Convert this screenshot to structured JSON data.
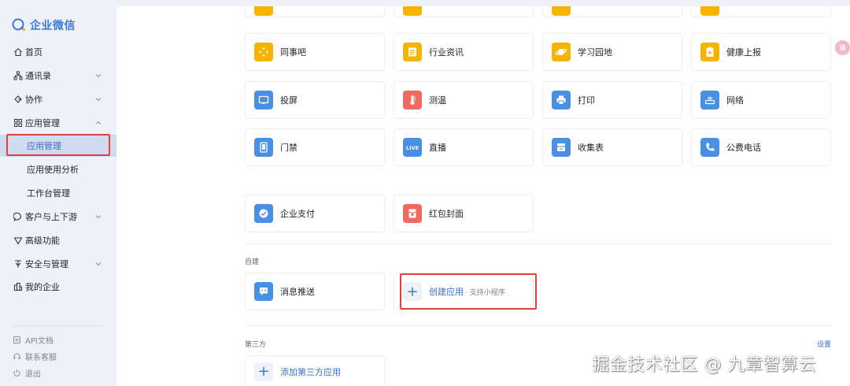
{
  "brand": {
    "name": "企业微信",
    "color": "#3a78d4"
  },
  "sidebar": {
    "items": [
      {
        "label": "首页",
        "icon": "home-icon"
      },
      {
        "label": "通讯录",
        "icon": "org-chart-icon"
      },
      {
        "label": "协作",
        "icon": "collaboration-icon"
      },
      {
        "label": "应用管理",
        "icon": "grid-icon"
      },
      {
        "label": "应用管理",
        "icon": ""
      },
      {
        "label": "应用使用分析",
        "icon": ""
      },
      {
        "label": "工作台管理",
        "icon": ""
      },
      {
        "label": "客户与上下游",
        "icon": "chat-bubble-icon"
      },
      {
        "label": "高级功能",
        "icon": "diamond-icon"
      },
      {
        "label": "安全与管理",
        "icon": "shield-icon"
      },
      {
        "label": "我的企业",
        "icon": "building-icon"
      }
    ],
    "footer": [
      {
        "label": "API文档",
        "icon": "document-icon"
      },
      {
        "label": "联系客服",
        "icon": "headset-icon"
      },
      {
        "label": "退出",
        "icon": "power-icon"
      }
    ]
  },
  "apps": {
    "rows": [
      [
        {
          "name": "同事吧",
          "icon": "cross-arrows-icon",
          "color": "#f5b400"
        },
        {
          "name": "行业资讯",
          "icon": "news-icon",
          "color": "#f5b400"
        },
        {
          "name": "学习园地",
          "icon": "planet-icon",
          "color": "#f5b400"
        },
        {
          "name": "健康上报",
          "icon": "health-report-icon",
          "color": "#f5b400"
        }
      ],
      [
        {
          "name": "投屏",
          "icon": "screen-cast-icon",
          "color": "#4a90e2"
        },
        {
          "name": "测温",
          "icon": "thermometer-icon",
          "color": "#f06a5f"
        },
        {
          "name": "打印",
          "icon": "printer-icon",
          "color": "#4a90e2"
        },
        {
          "name": "网络",
          "icon": "network-icon",
          "color": "#4a90e2"
        }
      ],
      [
        {
          "name": "门禁",
          "icon": "door-icon",
          "color": "#4a90e2"
        },
        {
          "name": "直播",
          "icon": "live-icon",
          "color": "#4a90e2"
        },
        {
          "name": "收集表",
          "icon": "form-icon",
          "color": "#4a90e2"
        },
        {
          "name": "公费电话",
          "icon": "phone-icon",
          "color": "#4a90e2"
        }
      ],
      [
        {
          "name": "企业支付",
          "icon": "payment-icon",
          "color": "#4a90e2"
        },
        {
          "name": "红包封面",
          "icon": "red-packet-icon",
          "color": "#f06a5f"
        }
      ]
    ]
  },
  "custom_section": {
    "label": "自建",
    "message_push": "消息推送",
    "create_label": "创建应用",
    "create_sub": "· 支持小程序"
  },
  "third_party": {
    "label": "第三方",
    "settings": "设置",
    "add_label": "添加第三方应用"
  },
  "watermark": "掘金技术社区 @ 九章智算云"
}
